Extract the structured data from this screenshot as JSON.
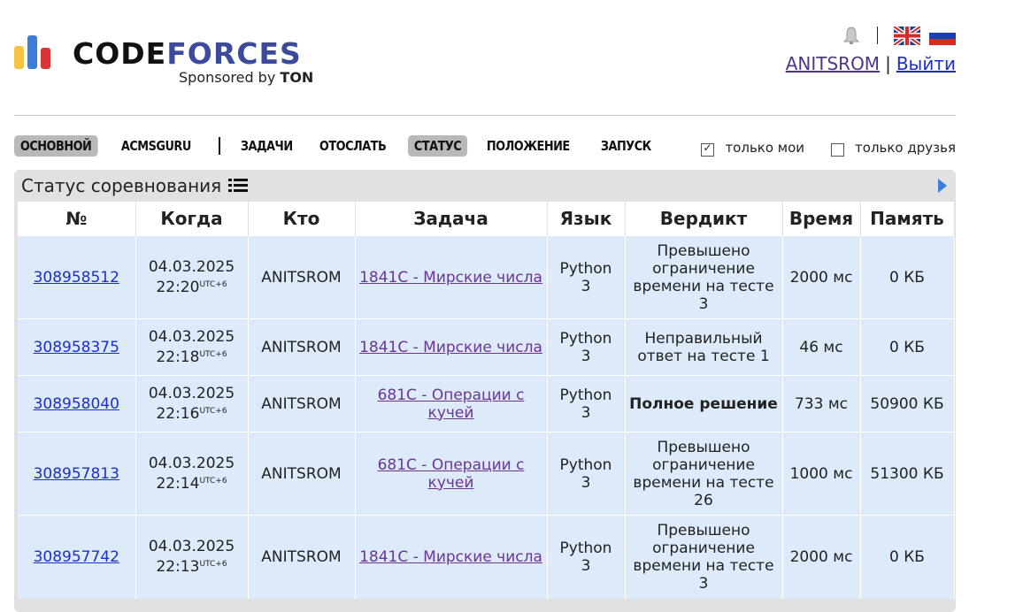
{
  "header": {
    "brand_part1": "CODE",
    "brand_part2": "FORCES",
    "sponsor_text": "Sponsored by",
    "sponsor_name": "TON",
    "username": "ANITSROM",
    "logout": "Выйти",
    "icons": [
      "bell-icon",
      "flag-uk-icon",
      "flag-ru-icon"
    ]
  },
  "nav": {
    "items": [
      "ОСНОВНОЙ",
      "ACMSGURU",
      "ЗАДАЧИ",
      "ОТОСЛАТЬ",
      "СТАТУС",
      "ПОЛОЖЕНИЕ",
      "ЗАПУСК"
    ],
    "active": [
      "ОСНОВНОЙ",
      "СТАТУС"
    ]
  },
  "filters": {
    "only_mine": {
      "label": "только мои",
      "checked": true
    },
    "only_friends": {
      "label": "только друзья",
      "checked": false
    }
  },
  "panel": {
    "title": "Статус соревнования"
  },
  "table": {
    "headers": [
      "№",
      "Когда",
      "Кто",
      "Задача",
      "Язык",
      "Вердикт",
      "Время",
      "Память"
    ],
    "tz": "UTC+6",
    "rows": [
      {
        "id": "308958512",
        "date": "04.03.2025",
        "time": "22:20",
        "who": "ANITSROM",
        "problem": "1841C - Мирские числа",
        "lang1": "Python",
        "lang2": "3",
        "verdict": "Превышено ограничение времени на тесте 3",
        "verdict_type": "fail",
        "runtime": "2000 мс",
        "memory": "0 КБ"
      },
      {
        "id": "308958375",
        "date": "04.03.2025",
        "time": "22:18",
        "who": "ANITSROM",
        "problem": "1841C - Мирские числа",
        "lang1": "Python",
        "lang2": "3",
        "verdict": "Неправильный ответ на тесте 1",
        "verdict_type": "fail",
        "runtime": "46 мс",
        "memory": "0 КБ"
      },
      {
        "id": "308958040",
        "date": "04.03.2025",
        "time": "22:16",
        "who": "ANITSROM",
        "problem": "681C - Операции с кучей",
        "lang1": "Python",
        "lang2": "3",
        "verdict": "Полное решение",
        "verdict_type": "ok",
        "runtime": "733 мс",
        "memory": "50900 КБ"
      },
      {
        "id": "308957813",
        "date": "04.03.2025",
        "time": "22:14",
        "who": "ANITSROM",
        "problem": "681C - Операции с кучей",
        "lang1": "Python",
        "lang2": "3",
        "verdict": "Превышено ограничение времени на тесте 26",
        "verdict_type": "fail",
        "runtime": "1000 мс",
        "memory": "51300 КБ"
      },
      {
        "id": "308957742",
        "date": "04.03.2025",
        "time": "22:13",
        "who": "ANITSROM",
        "problem": "1841C - Мирские числа",
        "lang1": "Python",
        "lang2": "3",
        "verdict": "Превышено ограничение времени на тесте 3",
        "verdict_type": "fail",
        "runtime": "2000 мс",
        "memory": "0 КБ"
      }
    ]
  }
}
